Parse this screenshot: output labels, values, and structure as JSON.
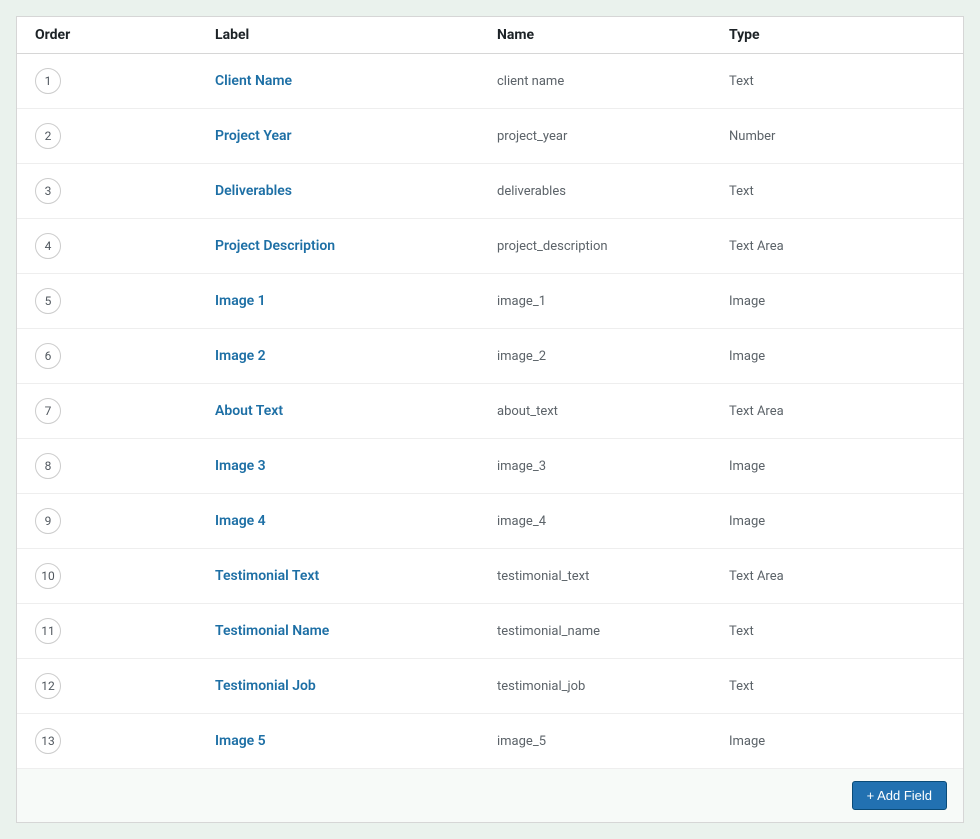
{
  "table": {
    "headers": {
      "order": "Order",
      "label": "Label",
      "name": "Name",
      "type": "Type"
    },
    "rows": [
      {
        "order": "1",
        "label": "Client Name",
        "name": "client name",
        "type": "Text"
      },
      {
        "order": "2",
        "label": "Project Year",
        "name": "project_year",
        "type": "Number"
      },
      {
        "order": "3",
        "label": "Deliverables",
        "name": "deliverables",
        "type": "Text"
      },
      {
        "order": "4",
        "label": "Project Description",
        "name": "project_description",
        "type": "Text Area"
      },
      {
        "order": "5",
        "label": "Image 1",
        "name": "image_1",
        "type": "Image"
      },
      {
        "order": "6",
        "label": "Image 2",
        "name": "image_2",
        "type": "Image"
      },
      {
        "order": "7",
        "label": "About Text",
        "name": "about_text",
        "type": "Text Area"
      },
      {
        "order": "8",
        "label": "Image 3",
        "name": "image_3",
        "type": "Image"
      },
      {
        "order": "9",
        "label": "Image 4",
        "name": "image_4",
        "type": "Image"
      },
      {
        "order": "10",
        "label": "Testimonial Text",
        "name": "testimonial_text",
        "type": "Text Area"
      },
      {
        "order": "11",
        "label": "Testimonial Name",
        "name": "testimonial_name",
        "type": "Text"
      },
      {
        "order": "12",
        "label": "Testimonial Job",
        "name": "testimonial_job",
        "type": "Text"
      },
      {
        "order": "13",
        "label": "Image 5",
        "name": "image_5",
        "type": "Image"
      }
    ],
    "footer": {
      "add_field_label": "+ Add Field"
    }
  }
}
